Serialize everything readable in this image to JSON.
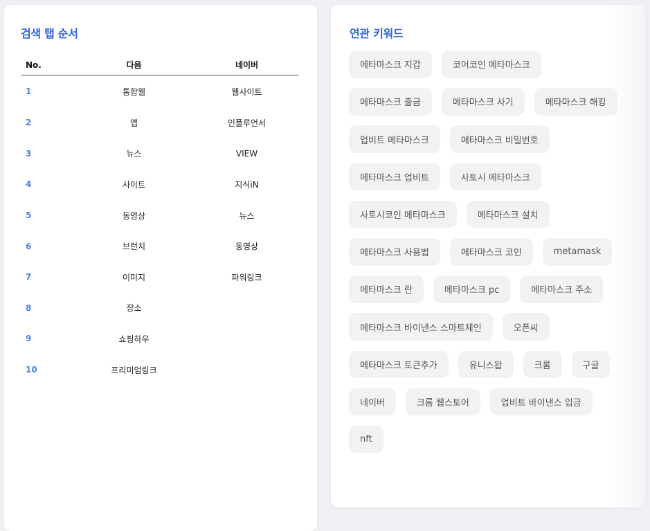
{
  "search_tab_order": {
    "title": "검색 탭 순서",
    "headers": [
      "No.",
      "다음",
      "네이버"
    ],
    "rows": [
      {
        "no": "1",
        "daum": "통합웹",
        "naver": "웹사이트"
      },
      {
        "no": "2",
        "daum": "앱",
        "naver": "인플루언서"
      },
      {
        "no": "3",
        "daum": "뉴스",
        "naver": "VIEW"
      },
      {
        "no": "4",
        "daum": "사이트",
        "naver": "지식iN"
      },
      {
        "no": "5",
        "daum": "동영상",
        "naver": "뉴스"
      },
      {
        "no": "6",
        "daum": "브런치",
        "naver": "동영상"
      },
      {
        "no": "7",
        "daum": "이미지",
        "naver": "파워링크"
      },
      {
        "no": "8",
        "daum": "장소",
        "naver": ""
      },
      {
        "no": "9",
        "daum": "쇼핑하우",
        "naver": ""
      },
      {
        "no": "10",
        "daum": "프리미엄링크",
        "naver": ""
      }
    ]
  },
  "related_keywords": {
    "title": "연관 키워드",
    "items": [
      "메타마스크 지갑",
      "코어코인 메타마스크",
      "메타마스크 출금",
      "메타마스크 사기",
      "메타마스크 해킹",
      "업비트 메타마스크",
      "메타마스크 비밀번호",
      "메타마스크 업비트",
      "사토시 메타마스크",
      "사토시코인 메타마스크",
      "메타마스크 설치",
      "메타마스크 사용법",
      "메타마스크 코인",
      "metamask",
      "메타마스크 란",
      "메타마스크 pc",
      "메타마스크 주소",
      "메타마스크 바이낸스 스마트체인",
      "오픈씨",
      "메타마스크 토큰추가",
      "유니스왑",
      "크롬",
      "구글",
      "네이버",
      "크롬 웹스토어",
      "업비트 바이낸스 입금",
      "nft"
    ]
  },
  "colors": {
    "accent": "#3166d8",
    "number": "#4f82e6",
    "chip_bg": "#f1f2f4",
    "page_bg": "#eef0f4"
  }
}
